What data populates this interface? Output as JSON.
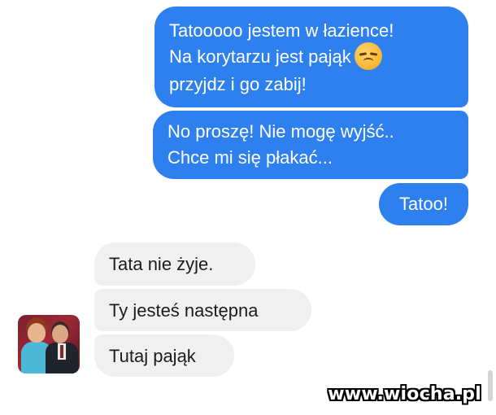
{
  "messages_sent": [
    {
      "lines": [
        "Tatooooo jestem w łazience!",
        "Na korytarzu jest pająk",
        "przyjdz i go zabij!"
      ],
      "emoji": "disappointed-face-icon"
    },
    {
      "lines": [
        "No proszę! Nie mogę wyjść..",
        "Chce mi się płakać..."
      ]
    },
    {
      "lines": [
        "Tatoo!"
      ]
    }
  ],
  "messages_received": [
    {
      "text": "Tata nie żyje."
    },
    {
      "text": "Ty jesteś następna"
    },
    {
      "text": "Tutaj pająk"
    }
  ],
  "colors": {
    "sent_bubble": "#2f80ef",
    "received_bubble": "#f1f0f0",
    "background": "#ffffff"
  },
  "watermark": "www.wiocha.pl"
}
